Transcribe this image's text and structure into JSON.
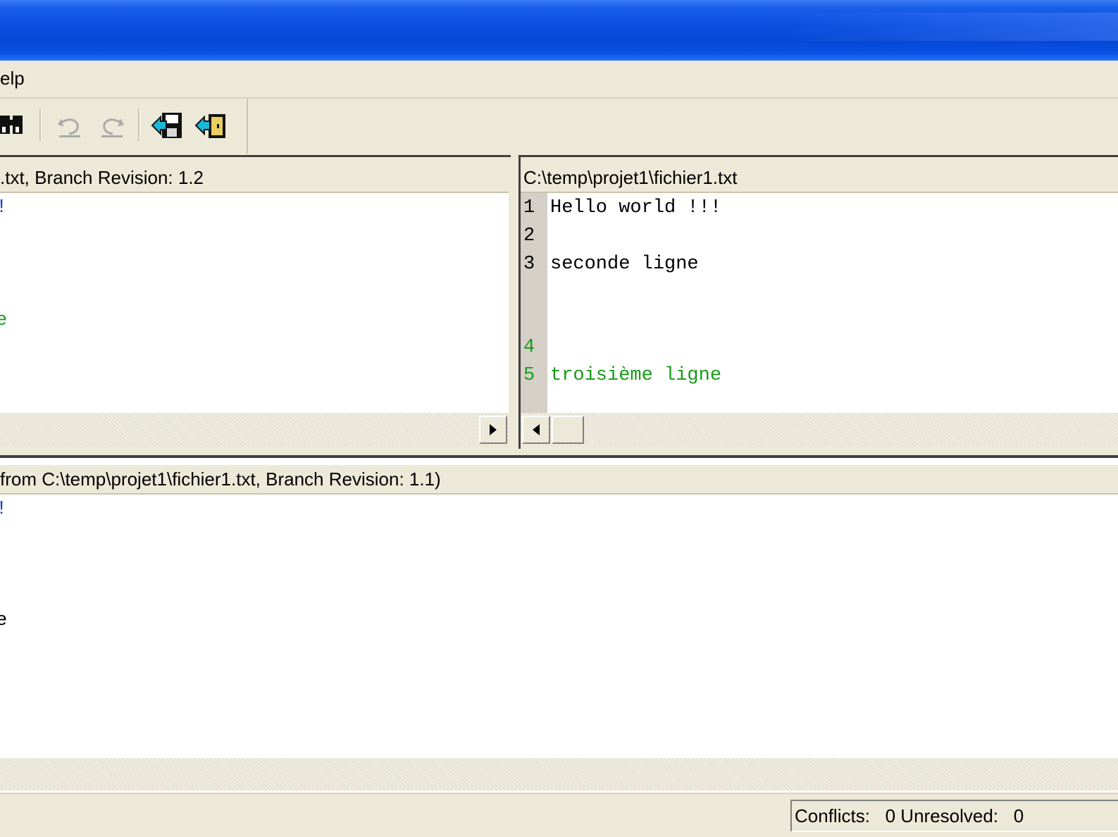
{
  "menubar": {
    "help_label": "elp"
  },
  "left_pane": {
    "header": ".txt, Branch Revision: 1.2",
    "lines": [
      {
        "text": "!",
        "color": "#1a3ec8"
      },
      {
        "text": "e",
        "color": "#1a9a1a"
      }
    ]
  },
  "right_pane": {
    "header": "C:\\temp\\projet1\\fichier1.txt",
    "lines": [
      {
        "num": "1",
        "text": "Hello world !!!"
      },
      {
        "num": "2",
        "text": ""
      },
      {
        "num": "3",
        "text": "seconde ligne"
      },
      {
        "num": "4",
        "text": ""
      },
      {
        "num": "5",
        "text": "troisième ligne"
      }
    ]
  },
  "bottom_pane": {
    "header": " from C:\\temp\\projet1\\fichier1.txt, Branch Revision: 1.1)",
    "lines": [
      {
        "text": "!",
        "color": "#1a3ec8"
      },
      {
        "text": "e",
        "color": "#000000"
      }
    ]
  },
  "statusbar": {
    "conflicts_label": "Conflicts:",
    "conflicts_value": "0",
    "unresolved_label": "Unresolved:",
    "unresolved_value": "0"
  },
  "colors": {
    "title_blue": "#0a4fe0",
    "chrome": "#ece9d8",
    "changed_line": "#1a9a1a"
  },
  "icons": [
    "find-icon",
    "undo-icon",
    "redo-icon",
    "save-icon",
    "exit-icon",
    "scroll-right-icon",
    "scroll-left-icon"
  ]
}
